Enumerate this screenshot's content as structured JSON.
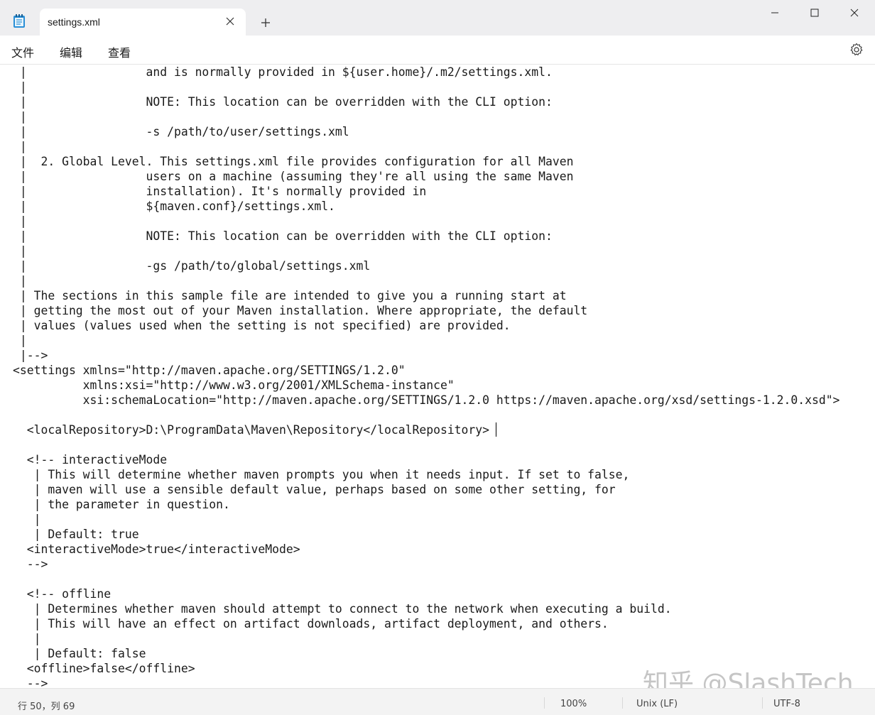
{
  "tab": {
    "title": "settings.xml"
  },
  "menu": [
    "文件",
    "编辑",
    "查看"
  ],
  "editor": {
    "lines": [
      " |                 and is normally provided in ${user.home}/.m2/settings.xml.",
      " |",
      " |                 NOTE: This location can be overridden with the CLI option:",
      " |",
      " |                 -s /path/to/user/settings.xml",
      " |",
      " |  2. Global Level. This settings.xml file provides configuration for all Maven",
      " |                 users on a machine (assuming they're all using the same Maven",
      " |                 installation). It's normally provided in",
      " |                 ${maven.conf}/settings.xml.",
      " |",
      " |                 NOTE: This location can be overridden with the CLI option:",
      " |",
      " |                 -gs /path/to/global/settings.xml",
      " |",
      " | The sections in this sample file are intended to give you a running start at",
      " | getting the most out of your Maven installation. Where appropriate, the default",
      " | values (values used when the setting is not specified) are provided.",
      " |",
      " |-->",
      "<settings xmlns=\"http://maven.apache.org/SETTINGS/1.2.0\"",
      "          xmlns:xsi=\"http://www.w3.org/2001/XMLSchema-instance\"",
      "          xsi:schemaLocation=\"http://maven.apache.org/SETTINGS/1.2.0 https://maven.apache.org/xsd/settings-1.2.0.xsd\">",
      "",
      "  <localRepository>D:\\ProgramData\\Maven\\Repository</localRepository>",
      "",
      "  <!-- interactiveMode",
      "   | This will determine whether maven prompts you when it needs input. If set to false,",
      "   | maven will use a sensible default value, perhaps based on some other setting, for",
      "   | the parameter in question.",
      "   |",
      "   | Default: true",
      "  <interactiveMode>true</interactiveMode>",
      "  -->",
      "",
      "  <!-- offline",
      "   | Determines whether maven should attempt to connect to the network when executing a build.",
      "   | This will have an effect on artifact downloads, artifact deployment, and others.",
      "   |",
      "   | Default: false",
      "  <offline>false</offline>",
      "  -->"
    ]
  },
  "watermark": "知乎 @SlashTech",
  "status": {
    "position": "行 50，列 69",
    "zoom": "100%",
    "line_ending": "Unix (LF)",
    "encoding": "UTF-8"
  },
  "icons": {
    "app": "notepad-icon",
    "close_tab": "close-icon",
    "new_tab": "plus-icon",
    "minimize": "minimize-icon",
    "maximize": "maximize-icon",
    "close_window": "close-window-icon",
    "settings": "gear-icon"
  }
}
